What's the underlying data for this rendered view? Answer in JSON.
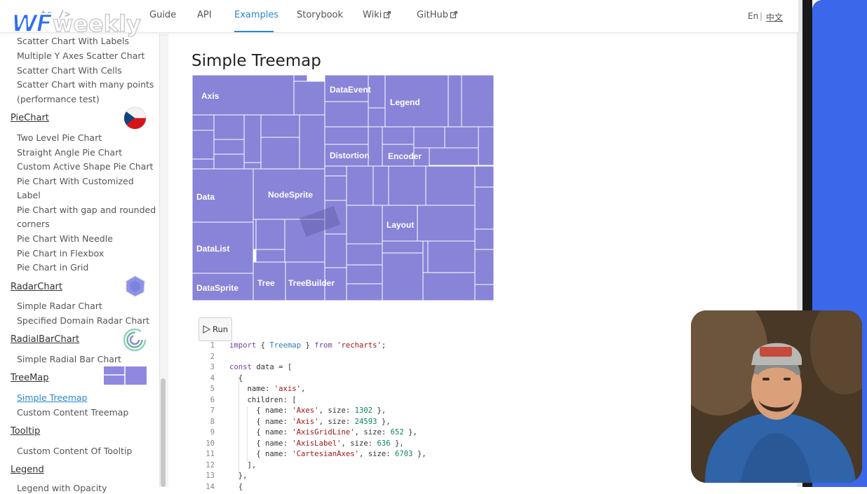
{
  "brand": {
    "ghost_text": "ts />",
    "logo_bold": "WF",
    "logo_text": "weekly"
  },
  "nav": {
    "guide": "Guide",
    "api": "API",
    "examples": "Examples",
    "storybook": "Storybook",
    "wiki": "Wiki",
    "github": "GitHub",
    "lang_en": "En",
    "lang_sep": "|",
    "lang_zh": "中文"
  },
  "sidebar": {
    "scatter_items": [
      "Scatter Chart With Labels",
      "Multiple Y Axes Scatter Chart",
      "Scatter Chart With Cells",
      "Scatter Chart with many points",
      "(performance test)"
    ],
    "pie": {
      "category": "PieChart",
      "items": [
        "Two Level Pie Chart",
        "Straight Angle Pie Chart",
        "Custom Active Shape Pie Chart",
        "Pie Chart With Customized",
        "Label",
        "Pie Chart with gap and rounded",
        "corners",
        "Pie Chart With Needle",
        "Pie Chart in Flexbox",
        "Pie Chart in Grid"
      ]
    },
    "radar": {
      "category": "RadarChart",
      "items": [
        "Simple Radar Chart",
        "Specified Domain Radar Chart"
      ]
    },
    "radialbar": {
      "category": "RadialBarChart",
      "items": [
        "Simple Radial Bar Chart"
      ]
    },
    "treemap": {
      "category": "TreeMap",
      "items": [
        "Simple Treemap",
        "Custom Content Treemap"
      ]
    },
    "tooltip": {
      "category": "Tooltip",
      "items": [
        "Custom Content Of Tooltip"
      ]
    },
    "legend": {
      "category": "Legend",
      "items": [
        "Legend with Opacity"
      ]
    }
  },
  "main": {
    "title": "Simple Treemap",
    "run_label": "Run"
  },
  "chart_data": {
    "type": "treemap",
    "fill_color": "#8884d8",
    "stroke_color": "#ffffff",
    "labeled_nodes": [
      "Axis",
      "DataEvent",
      "Legend",
      "Distortion",
      "Encoder",
      "Data",
      "NodeSprite",
      "Layout",
      "DataList",
      "DataSprite",
      "Tree",
      "TreeBuilder"
    ]
  },
  "code": {
    "line_numbers": [
      "1",
      "2",
      "3",
      "4",
      "5",
      "6",
      "7",
      "8",
      "9",
      "10",
      "11",
      "12",
      "13",
      "14"
    ],
    "lines": [
      "import { Treemap } from 'recharts';",
      "",
      "const data = [",
      "  {",
      "    name: 'axis',",
      "    children: [",
      "      { name: 'Axes', size: 1302 },",
      "      { name: 'Axis', size: 24593 },",
      "      { name: 'AxisGridLine', size: 652 },",
      "      { name: 'AxisLabel', size: 636 },",
      "      { name: 'CartesianAxes', size: 6703 },",
      "    ],",
      "  },",
      "  {"
    ]
  }
}
